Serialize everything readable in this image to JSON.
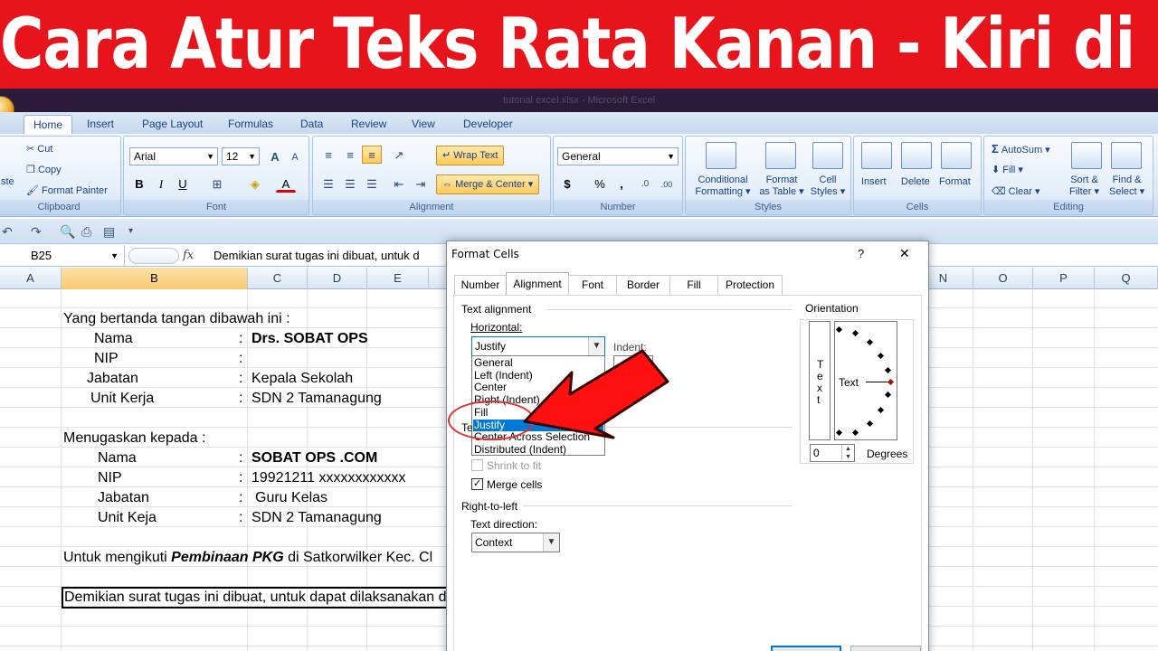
{
  "banner": {
    "text": "Cara Atur Teks Rata Kanan - Kiri di Excel"
  },
  "window": {
    "title": "tutorial excel.xlsx - Microsoft Excel"
  },
  "ribbon_tabs": [
    "Home",
    "Insert",
    "Page Layout",
    "Formulas",
    "Data",
    "Review",
    "View",
    "Developer"
  ],
  "clipboard": {
    "paste": "ste",
    "cut": "Cut",
    "copy": "Copy",
    "format_painter": "Format Painter",
    "label": "Clipboard"
  },
  "font": {
    "name": "Arial",
    "size": "12",
    "label": "Font",
    "grow": "A",
    "shrink": "A",
    "bold": "B",
    "italic": "I",
    "underline": "U",
    "color_glyph": "A"
  },
  "alignment": {
    "wrap_text": "Wrap Text",
    "merge_center": "Merge & Center",
    "label": "Alignment"
  },
  "number": {
    "format": "General",
    "currency": "$",
    "percent": "%",
    "comma": ",",
    "inc_decimal": ".0",
    "dec_decimal": ".00",
    "label": "Number"
  },
  "styles": {
    "conditional_1": "Conditional",
    "conditional_2": "Formatting",
    "format_table_1": "Format",
    "format_table_2": "as Table",
    "cell_styles_1": "Cell",
    "cell_styles_2": "Styles",
    "label": "Styles"
  },
  "cells": {
    "insert": "Insert",
    "delete": "Delete",
    "format": "Format",
    "label": "Cells"
  },
  "editing": {
    "autosum": "AutoSum",
    "sigma": "Σ",
    "fill": "Fill",
    "clear": "Clear",
    "sort_1": "Sort &",
    "sort_2": "Filter",
    "find_1": "Find &",
    "find_2": "Select",
    "label": "Editing"
  },
  "formula_bar": {
    "name_box": "B25",
    "fx": "fx",
    "content": "Demikian surat tugas ini dibuat, untuk d"
  },
  "columns": [
    "A",
    "B",
    "C",
    "D",
    "E",
    "N",
    "O",
    "P",
    "Q"
  ],
  "sheet": {
    "r1": {
      "text": "Yang bertanda tangan dibawah ini :"
    },
    "r2": {
      "label": "Nama",
      "colon": ":",
      "value": "Drs. SOBAT OPS"
    },
    "r3": {
      "label": "NIP",
      "colon": ":",
      "value": ""
    },
    "r4": {
      "label": "Jabatan",
      "colon": ":",
      "value": "Kepala Sekolah"
    },
    "r5": {
      "label": "Unit Kerja",
      "colon": ":",
      "value": "SDN 2 Tamanagung"
    },
    "r6": {
      "text": "Menugaskan kepada :"
    },
    "r7": {
      "label": "Nama",
      "colon": ":",
      "value": "SOBAT OPS .COM"
    },
    "r8": {
      "label": "NIP",
      "colon": ":",
      "value": "19921211 xxxxxxxxxxxx"
    },
    "r9": {
      "label": "Jabatan",
      "colon": ":",
      "value": "Guru Kelas"
    },
    "r10": {
      "label": "Unit Keja",
      "colon": ":",
      "value": "SDN 2 Tamanagung"
    },
    "r11": {
      "pre": "Untuk mengikuti",
      "bold": "Pembinaan PKG",
      "post": "di Satkorwilker Kec. Cl"
    },
    "r12": {
      "text": "Demikian surat tugas ini dibuat, untuk dapat dilaksanakan d"
    }
  },
  "dialog": {
    "title": "Format Cells",
    "help": "?",
    "close": "✕",
    "tabs": [
      "Number",
      "Alignment",
      "Font",
      "Border",
      "Fill",
      "Protection"
    ],
    "text_alignment": "Text alignment",
    "horizontal": "Horizontal:",
    "horizontal_value": "Justify",
    "indent": "Indent:",
    "horizontal_options": [
      "General",
      "Left (Indent)",
      "Center",
      "Right (Indent)",
      "Fill",
      "Justify",
      "Center Across Selection",
      "Distributed (Indent)"
    ],
    "text_control_partial": "Te",
    "shrink_to_fit": "Shrink to fit",
    "merge_cells": "Merge cells",
    "right_to_left": "Right-to-left",
    "text_direction": "Text direction:",
    "text_direction_value": "Context",
    "orientation": "Orientation",
    "vertical_text": [
      "T",
      "e",
      "x",
      "t"
    ],
    "dial_text": "Text",
    "degrees_value": "0",
    "degrees": "Degrees"
  }
}
